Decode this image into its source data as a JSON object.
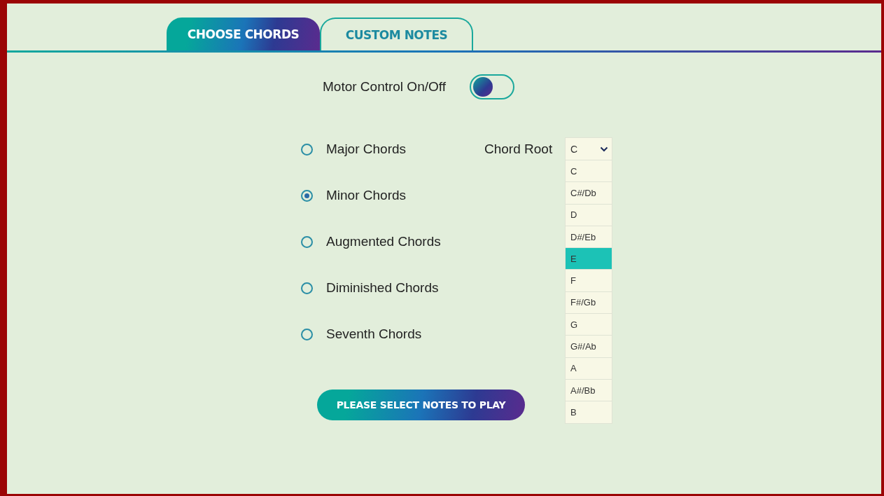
{
  "tabs": [
    {
      "label": "CHOOSE CHORDS",
      "selected": true
    },
    {
      "label": "CUSTOM NOTES",
      "selected": false
    }
  ],
  "motor_control": {
    "label": "Motor Control On/Off",
    "on": false
  },
  "chord_types": [
    {
      "label": "Major Chords",
      "selected": false
    },
    {
      "label": "Minor Chords",
      "selected": true
    },
    {
      "label": "Augmented Chords",
      "selected": false
    },
    {
      "label": "Diminished Chords",
      "selected": false
    },
    {
      "label": "Seventh Chords",
      "selected": false
    }
  ],
  "chord_root": {
    "label": "Chord Root",
    "value": "C",
    "options": [
      {
        "label": "C",
        "highlighted": false
      },
      {
        "label": "C#/Db",
        "highlighted": false
      },
      {
        "label": "D",
        "highlighted": false
      },
      {
        "label": "D#/Eb",
        "highlighted": false
      },
      {
        "label": "E",
        "highlighted": true
      },
      {
        "label": "F",
        "highlighted": false
      },
      {
        "label": "F#/Gb",
        "highlighted": false
      },
      {
        "label": "G",
        "highlighted": false
      },
      {
        "label": "G#/Ab",
        "highlighted": false
      },
      {
        "label": "A",
        "highlighted": false
      },
      {
        "label": "A#/Bb",
        "highlighted": false
      },
      {
        "label": "B",
        "highlighted": false
      }
    ]
  },
  "play_button": {
    "label": "PLEASE SELECT NOTES TO PLAY"
  }
}
